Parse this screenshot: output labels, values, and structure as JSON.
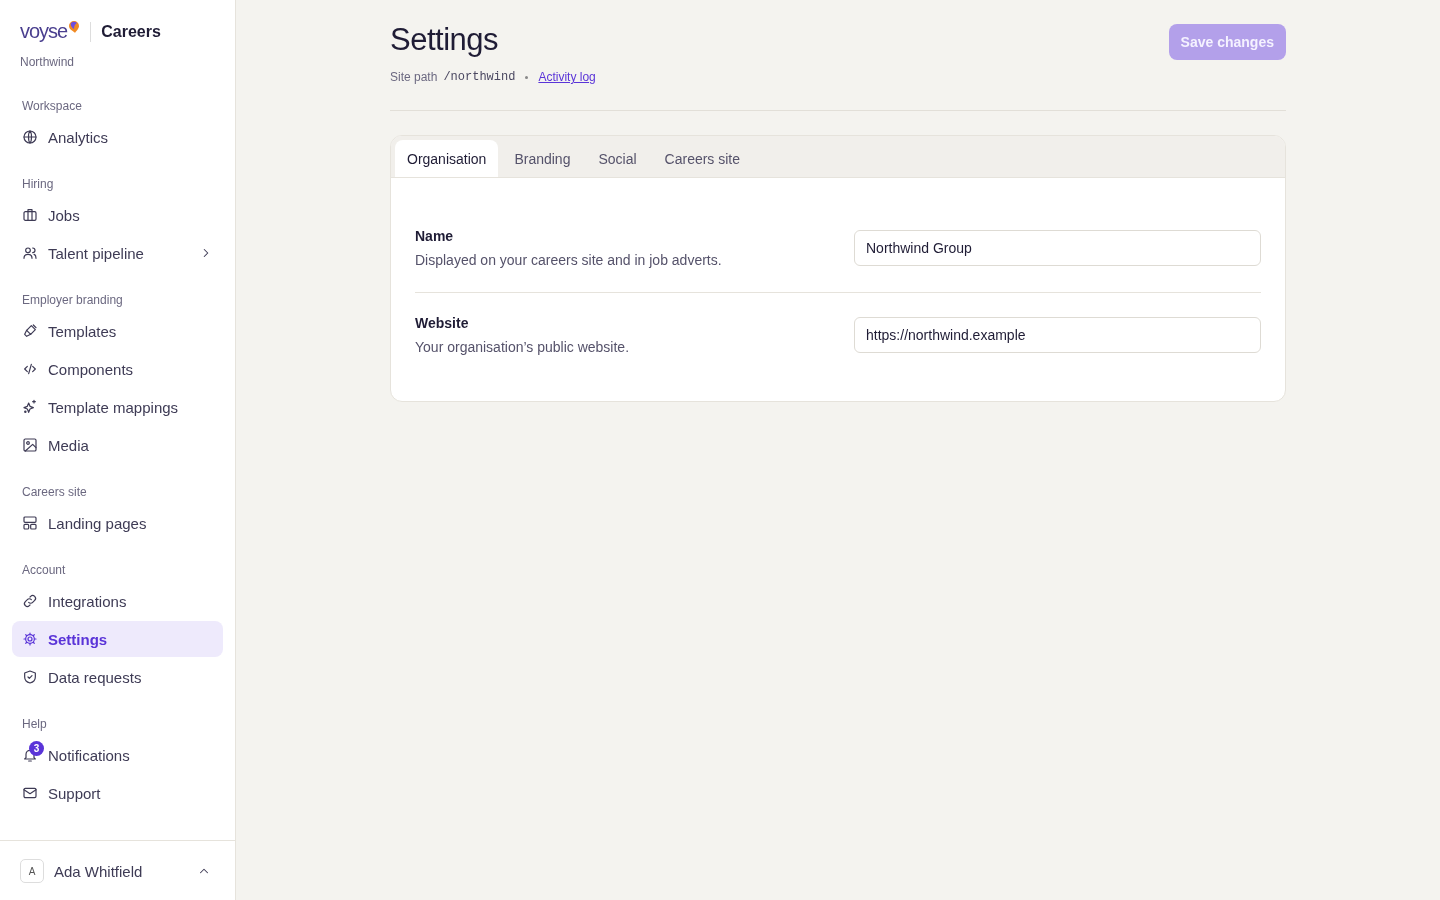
{
  "sidebar": {
    "brand": {
      "logo": "voyse",
      "product": "Careers",
      "org": "Northwind"
    },
    "sections": [
      {
        "label": "Workspace",
        "items": [
          {
            "kind": "globe",
            "label": "Analytics",
            "selected": false
          }
        ]
      },
      {
        "label": "Hiring",
        "items": [
          {
            "kind": "briefcase",
            "label": "Jobs",
            "selected": false
          },
          {
            "kind": "users",
            "label": "Talent pipeline",
            "selected": false,
            "expandable": true
          }
        ]
      },
      {
        "label": "Employer branding",
        "items": [
          {
            "kind": "brush",
            "label": "Templates",
            "selected": false
          },
          {
            "kind": "code",
            "label": "Components",
            "selected": false
          },
          {
            "kind": "sparkles",
            "label": "Template mappings",
            "selected": false
          },
          {
            "kind": "image",
            "label": "Media",
            "selected": false
          }
        ]
      },
      {
        "label": "Careers site",
        "items": [
          {
            "kind": "layout",
            "label": "Landing pages",
            "selected": false
          }
        ]
      },
      {
        "label": "Account",
        "items": [
          {
            "kind": "link",
            "label": "Integrations",
            "selected": false
          },
          {
            "kind": "gear",
            "label": "Settings",
            "selected": true
          },
          {
            "kind": "shield",
            "label": "Data requests",
            "selected": false
          }
        ]
      },
      {
        "label": "Help",
        "items": [
          {
            "kind": "bell",
            "label": "Notifications",
            "selected": false,
            "badge": "3"
          },
          {
            "kind": "mail",
            "label": "Support",
            "selected": false
          }
        ]
      }
    ],
    "user": {
      "initial": "A",
      "name": "Ada Whitfield"
    }
  },
  "header": {
    "title": "Settings",
    "path_label": "Site path",
    "path": "/northwind",
    "link": "Activity log",
    "save_button": {
      "label": "Save changes",
      "disabled": true
    }
  },
  "tabs": [
    {
      "label": "Organisation",
      "selected": true
    },
    {
      "label": "Branding",
      "selected": false
    },
    {
      "label": "Social",
      "selected": false
    },
    {
      "label": "Careers site",
      "selected": false
    }
  ],
  "fields": [
    {
      "label": "Name",
      "description": "Displayed on your careers site and in job adverts.",
      "value": "Northwind Group"
    },
    {
      "label": "Website",
      "description": "Your organisation’s public website.",
      "value": "https://northwind.example"
    }
  ]
}
